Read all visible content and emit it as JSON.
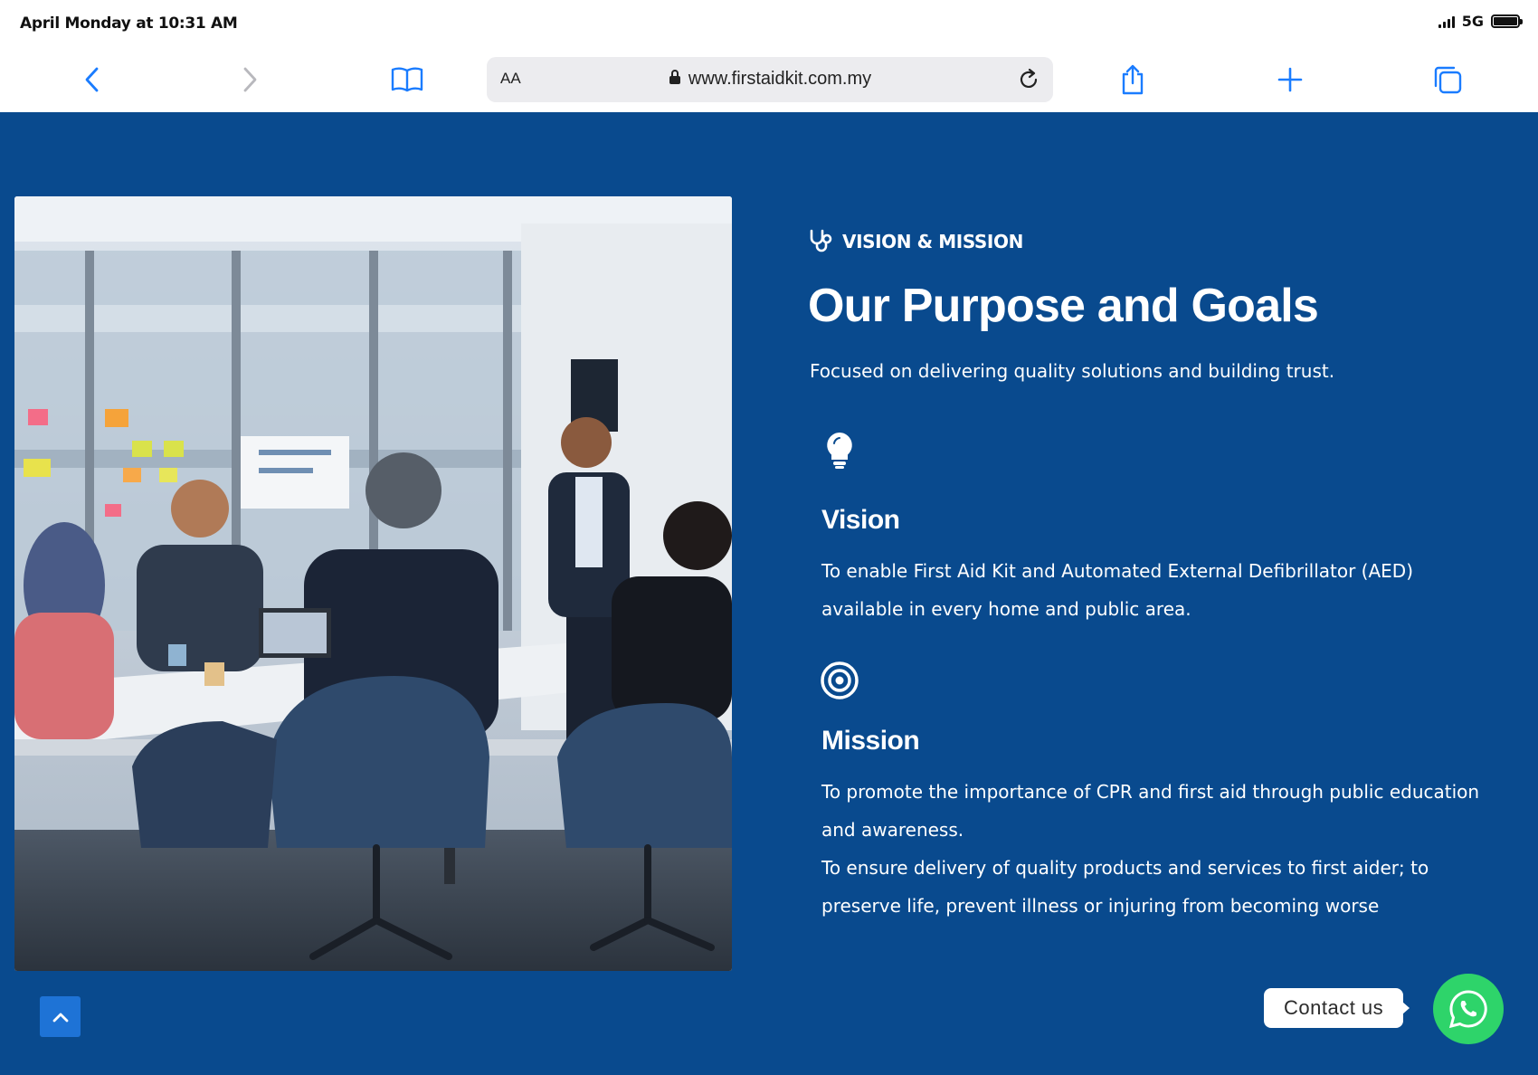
{
  "status_bar": {
    "time": "April Monday at 10:31 AM",
    "network": "5G"
  },
  "browser": {
    "text_size_label": "AA",
    "url": "www.firstaidkit.com.my",
    "accent_color": "#1a7cff"
  },
  "section": {
    "eyebrow": "VISION & MISSION",
    "eyebrow_icon": "stethoscope-icon",
    "title": "Our Purpose and Goals",
    "subtitle": "Focused on delivering quality solutions and building trust.",
    "background_color": "#094a8e",
    "vision": {
      "icon": "lightbulb-icon",
      "heading": "Vision",
      "text": "To enable First Aid Kit and Automated External Defibrillator (AED) available in every home and public area."
    },
    "mission": {
      "icon": "target-icon",
      "heading": "Mission",
      "text_1": "To promote the importance of CPR and first aid through public education and awareness.",
      "text_2": "To ensure delivery of quality products and services to first aider; to preserve life, prevent illness or injuring from becoming worse"
    }
  },
  "floating": {
    "contact_label": "Contact us",
    "whatsapp_color": "#2ed46a",
    "back_to_top_icon": "chevron-up-icon"
  }
}
